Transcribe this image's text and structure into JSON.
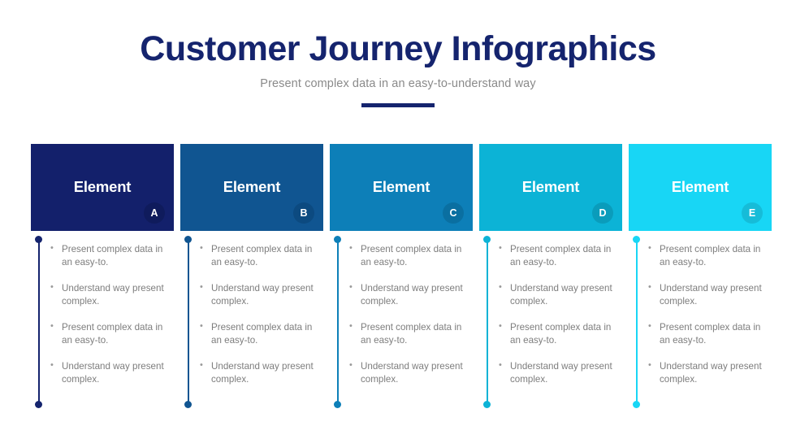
{
  "header": {
    "title": "Customer Journey Infographics",
    "subtitle": "Present complex data in an easy-to-understand way",
    "title_color": "#15246e",
    "subtitle_color": "#8a8a8a",
    "rule_color": "#15246e"
  },
  "columns": [
    {
      "card_label": "Element",
      "badge": "A",
      "card_color": "#13206b",
      "badge_color": "#0f1b5c",
      "accent_color": "#15246e",
      "bullets": [
        "Present complex data in an easy-to.",
        "Understand way present complex.",
        "Present complex data in an easy-to.",
        "Understand way present complex."
      ]
    },
    {
      "card_label": "Element",
      "badge": "B",
      "card_color": "#105591",
      "badge_color": "#0c4a80",
      "accent_color": "#105591",
      "bullets": [
        "Present complex data in an easy-to.",
        "Understand way present complex.",
        "Present complex data in an easy-to.",
        "Understand way present complex."
      ]
    },
    {
      "card_label": "Element",
      "badge": "C",
      "card_color": "#0d7fb8",
      "badge_color": "#0a6fa1",
      "accent_color": "#0d7fb8",
      "bullets": [
        "Present complex data in an easy-to.",
        "Understand way present complex.",
        "Present complex data in an easy-to.",
        "Understand way present complex."
      ]
    },
    {
      "card_label": "Element",
      "badge": "D",
      "card_color": "#0cb3d6",
      "badge_color": "#0a9cbb",
      "accent_color": "#0cb3d6",
      "bullets": [
        "Present complex data in an easy-to.",
        "Understand way present complex.",
        "Present complex data in an easy-to.",
        "Understand way present complex."
      ]
    },
    {
      "card_label": "Element",
      "badge": "E",
      "card_color": "#18d6f5",
      "badge_color": "#16bcd8",
      "accent_color": "#18d6f5",
      "bullets": [
        "Present complex data in an easy-to.",
        "Understand way present complex.",
        "Present complex data in an easy-to.",
        "Understand way present complex."
      ]
    }
  ]
}
